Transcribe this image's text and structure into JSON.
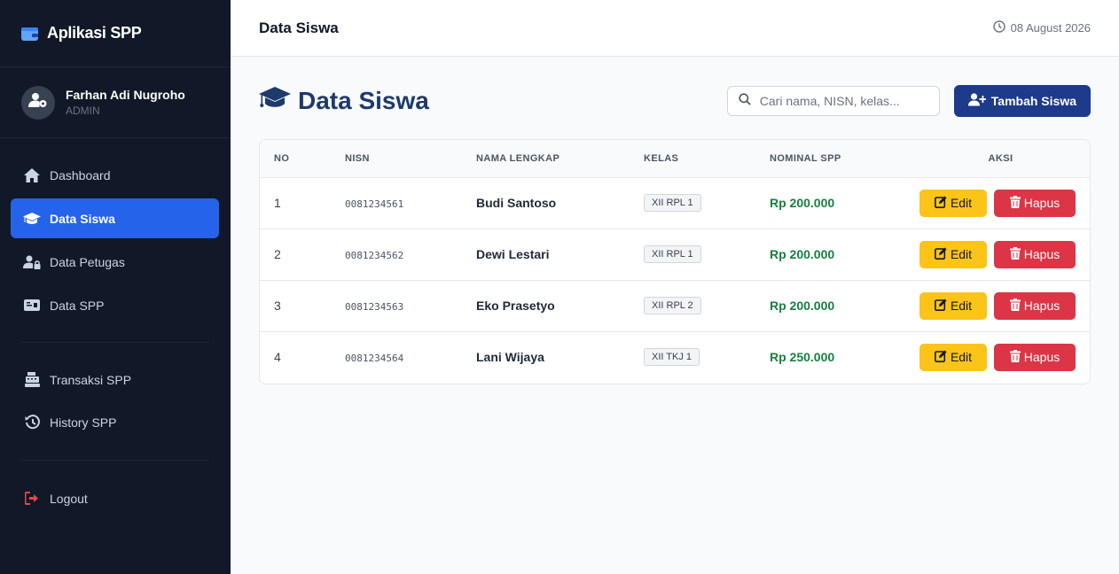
{
  "app": {
    "title": "Aplikasi SPP"
  },
  "profile": {
    "name": "Farhan Adi Nugroho",
    "role": "ADMIN"
  },
  "nav": {
    "dashboard": "Dashboard",
    "data_siswa": "Data Siswa",
    "data_petugas": "Data Petugas",
    "data_spp": "Data SPP",
    "transaksi_spp": "Transaksi SPP",
    "history_spp": "History SPP",
    "logout": "Logout"
  },
  "topbar": {
    "title": "Data Siswa",
    "date": "08 August 2026"
  },
  "page": {
    "title": "Data Siswa",
    "search_placeholder": "Cari nama, NISN, kelas...",
    "add_button": "Tambah Siswa"
  },
  "table": {
    "headers": {
      "no": "NO",
      "nisn": "NISN",
      "nama": "NAMA LENGKAP",
      "kelas": "KELAS",
      "spp": "NOMINAL SPP",
      "aksi": "AKSI"
    },
    "edit_label": "Edit",
    "delete_label": "Hapus",
    "rows": [
      {
        "no": "1",
        "nisn": "0081234561",
        "nama": "Budi Santoso",
        "kelas": "XII RPL 1",
        "spp": "Rp 200.000"
      },
      {
        "no": "2",
        "nisn": "0081234562",
        "nama": "Dewi Lestari",
        "kelas": "XII RPL 1",
        "spp": "Rp 200.000"
      },
      {
        "no": "3",
        "nisn": "0081234563",
        "nama": "Eko Prasetyo",
        "kelas": "XII RPL 2",
        "spp": "Rp 200.000"
      },
      {
        "no": "4",
        "nisn": "0081234564",
        "nama": "Lani Wijaya",
        "kelas": "XII TKJ 1",
        "spp": "Rp 250.000"
      }
    ]
  },
  "colors": {
    "sidebar_bg": "#111827",
    "active_nav": "#2563eb",
    "primary_button": "#1e3a8a",
    "title_color": "#1e3a6b",
    "edit_button": "#fcc419",
    "delete_button": "#dc3545",
    "spp_text": "#15803d",
    "logout_icon": "#ef4444"
  },
  "icons": {
    "brand": "wallet-icon",
    "avatar": "user-gear-icon",
    "dashboard": "home-icon",
    "data_siswa": "graduation-cap-icon",
    "data_petugas": "user-lock-icon",
    "data_spp": "money-bill-icon",
    "transaksi_spp": "cash-register-icon",
    "history_spp": "history-icon",
    "logout": "sign-out-icon",
    "date": "clock-icon",
    "search": "search-icon",
    "add": "user-plus-icon",
    "edit": "edit-icon",
    "delete": "trash-icon"
  }
}
